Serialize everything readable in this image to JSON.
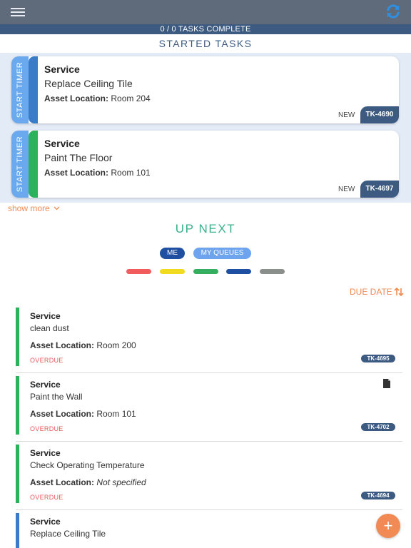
{
  "progress_text": "0 / 0 TASKS COMPLETE",
  "started_title": "STARTED TASKS",
  "started_tasks": [
    {
      "timer_label": "START TIMER",
      "category": "Service",
      "title": "Replace Ceiling Tile",
      "location_label": "Asset Location:",
      "location": "Room 204",
      "status": "NEW",
      "tag": "TK-4690",
      "color": "#3a7cc8"
    },
    {
      "timer_label": "START TIMER",
      "category": "Service",
      "title": "Paint The Floor",
      "location_label": "Asset Location:",
      "location": "Room 101",
      "status": "NEW",
      "tag": "TK-4697",
      "color": "#2cb25c"
    }
  ],
  "show_more_label": "show more",
  "up_next_title": "UP NEXT",
  "filters": {
    "me": "ME",
    "my_queues": "MY QUEUES"
  },
  "color_filters": [
    "#f35c5c",
    "#f0db1e",
    "#35af5d",
    "#1f4fa0",
    "#8a8f8c"
  ],
  "sort_label": "DUE DATE",
  "tasks": [
    {
      "category": "Service",
      "title": "clean dust",
      "location_label": "Asset Location:",
      "location": "Room 200",
      "due": "OVERDUE",
      "tag": "TK-4695",
      "color": "#2cb25c"
    },
    {
      "category": "Service",
      "title": "Paint the Wall",
      "location_label": "Asset Location:",
      "location": "Room 101",
      "due": "OVERDUE",
      "tag": "TK-4702",
      "color": "#2cb25c",
      "icon": "document-icon"
    },
    {
      "category": "Service",
      "title": "Check Operating Temperature",
      "location_label": "Asset Location:",
      "location": "Not specified",
      "due": "OVERDUE",
      "tag": "TK-4694",
      "color": "#2cb25c"
    },
    {
      "category": "Service",
      "title": "Replace Ceiling Tile",
      "color": "#3a7cc8"
    }
  ],
  "fab_label": "+",
  "icons": {
    "menu": "hamburger-menu-icon",
    "refresh": "refresh-icon",
    "show_more": "chevron-down-icon",
    "sort": "sort-icon",
    "add": "plus-icon"
  }
}
